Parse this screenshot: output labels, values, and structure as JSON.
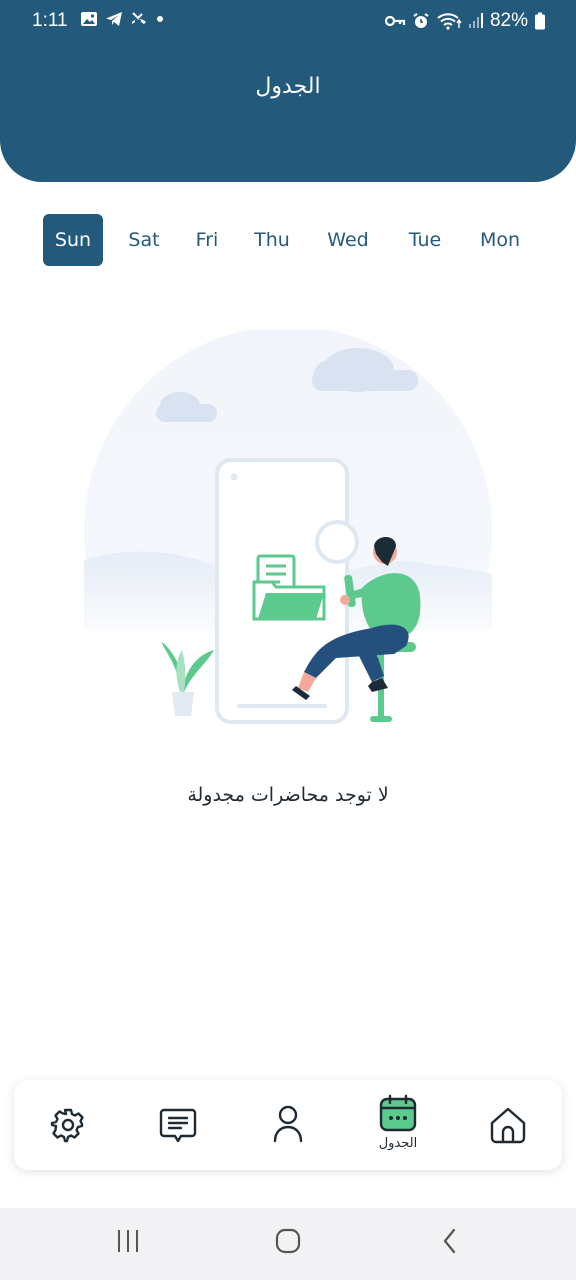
{
  "status_bar": {
    "time": "1:11",
    "battery_percent": "82%",
    "left_icons": [
      "image-icon",
      "telegram-icon",
      "missed-call-icon",
      "dot-icon"
    ],
    "right_icons": [
      "key-icon",
      "alarm-icon",
      "wifi-icon",
      "signal-icon",
      "battery-icon"
    ]
  },
  "header": {
    "title": "الجدول"
  },
  "days": {
    "selected": "Sun",
    "items": [
      {
        "label": "Sun"
      },
      {
        "label": "Sat"
      },
      {
        "label": "Fri"
      },
      {
        "label": "Thu"
      },
      {
        "label": "Wed"
      },
      {
        "label": "Tue"
      },
      {
        "label": "Mon"
      }
    ]
  },
  "empty_state": {
    "message": "لا توجد محاضرات مجدولة"
  },
  "bottom_nav": {
    "active": "schedule",
    "items": [
      {
        "id": "settings",
        "icon": "gear-icon",
        "label": ""
      },
      {
        "id": "messages",
        "icon": "chat-icon",
        "label": ""
      },
      {
        "id": "profile",
        "icon": "user-icon",
        "label": ""
      },
      {
        "id": "schedule",
        "icon": "calendar-icon",
        "label": "الجدول"
      },
      {
        "id": "home",
        "icon": "home-icon",
        "label": ""
      }
    ]
  },
  "system_nav": {
    "buttons": [
      "recent-apps-icon",
      "home-circle-icon",
      "back-icon"
    ]
  },
  "colors": {
    "primary": "#235a7c",
    "accent_green": "#5cc98d",
    "background": "#ffffff"
  }
}
